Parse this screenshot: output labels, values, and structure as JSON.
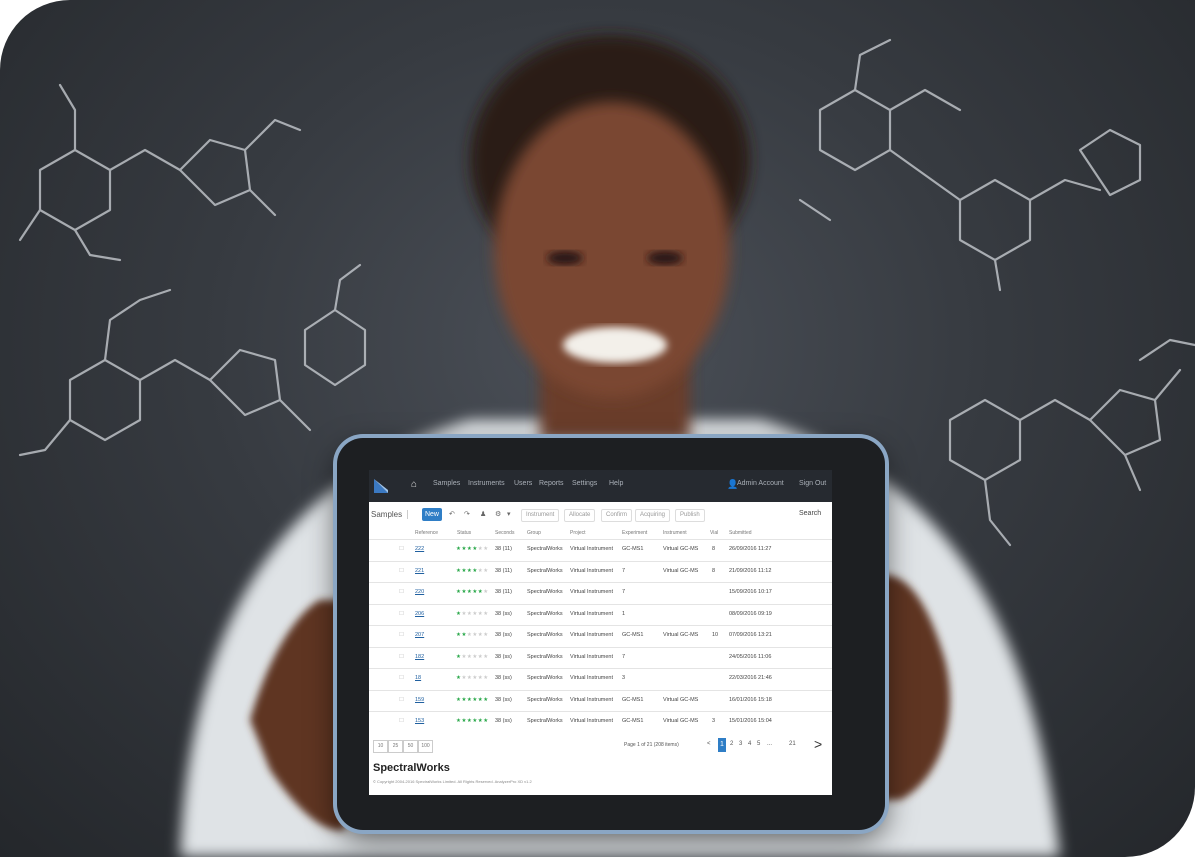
{
  "app": {
    "brand": "SpectralWorks",
    "copyright": "© Copyright 2004-2016 SpectralWorks Limited. All Rights Reserved. AnalyzerPro XD v1.2"
  },
  "nav": {
    "items": [
      "Samples",
      "Instruments",
      "Users",
      "Reports",
      "Settings",
      "Help"
    ],
    "user": "Admin Account",
    "sign_out": "Sign Out"
  },
  "toolbar": {
    "tab": "Samples",
    "new": "New",
    "filters": [
      "Instrument",
      "Allocate",
      "Confirm",
      "Acquiring",
      "Publish"
    ],
    "search": "Search"
  },
  "table": {
    "headers": [
      "Reference",
      "Status",
      "Seconds",
      "Group",
      "Project",
      "Experiment",
      "Instrument",
      "Vial",
      "Submitted"
    ],
    "rows": [
      {
        "ref": "222",
        "stars": 4,
        "secs": "38 (11)",
        "group": "SpectralWorks",
        "project": "Virtual Instrument",
        "exp": "GC-MS1",
        "inst": "Virtual GC-MS",
        "vial": "8",
        "date": "26/09/2016 11:27"
      },
      {
        "ref": "221",
        "stars": 4,
        "secs": "38 (11)",
        "group": "SpectralWorks",
        "project": "Virtual Instrument",
        "exp": "7",
        "inst": "Virtual GC-MS",
        "vial": "8",
        "date": "21/09/2016 11:12"
      },
      {
        "ref": "220",
        "stars": 5,
        "secs": "38 (11)",
        "group": "SpectralWorks",
        "project": "Virtual Instrument",
        "exp": "7",
        "inst": "",
        "vial": "",
        "date": "15/09/2016 10:17"
      },
      {
        "ref": "206",
        "stars": 1,
        "secs": "38 (ss)",
        "group": "SpectralWorks",
        "project": "Virtual Instrument",
        "exp": "1",
        "inst": "",
        "vial": "",
        "date": "08/09/2016 09:19"
      },
      {
        "ref": "207",
        "stars": 2,
        "secs": "38 (ss)",
        "group": "SpectralWorks",
        "project": "Virtual Instrument",
        "exp": "GC-MS1",
        "inst": "Virtual GC-MS",
        "vial": "10",
        "date": "07/09/2016 13:21"
      },
      {
        "ref": "182",
        "stars": 1,
        "secs": "38 (ss)",
        "group": "SpectralWorks",
        "project": "Virtual Instrument",
        "exp": "7",
        "inst": "",
        "vial": "",
        "date": "24/05/2016 11:06"
      },
      {
        "ref": "18",
        "stars": 1,
        "secs": "38 (ss)",
        "group": "SpectralWorks",
        "project": "Virtual Instrument",
        "exp": "3",
        "inst": "",
        "vial": "",
        "date": "22/03/2016 21:46"
      },
      {
        "ref": "159",
        "stars": 6,
        "secs": "38 (ss)",
        "group": "SpectralWorks",
        "project": "Virtual Instrument",
        "exp": "GC-MS1",
        "inst": "Virtual GC-MS",
        "vial": "",
        "date": "16/01/2016 15:18"
      },
      {
        "ref": "153",
        "stars": 6,
        "secs": "38 (ss)",
        "group": "SpectralWorks",
        "project": "Virtual Instrument",
        "exp": "GC-MS1",
        "inst": "Virtual GC-MS",
        "vial": "3",
        "date": "15/01/2016 15:04"
      }
    ]
  },
  "pager": {
    "sizes": [
      "10",
      "25",
      "50",
      "100"
    ],
    "summary": "Page 1 of 21 (208 items)",
    "prev": "<",
    "pages": [
      "1",
      "2",
      "3",
      "4",
      "5"
    ],
    "ellipsis": "...",
    "last": "21",
    "next": ">"
  }
}
